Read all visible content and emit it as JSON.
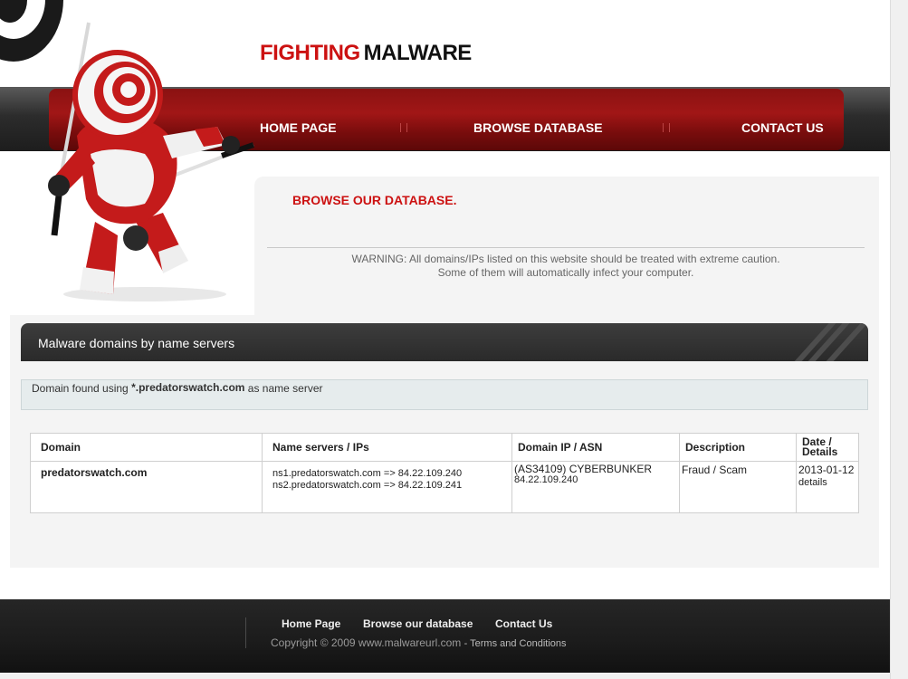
{
  "header": {
    "title_red": "FIGHTING",
    "title_black": "MALWARE"
  },
  "nav": {
    "items": [
      {
        "label": "HOME PAGE"
      },
      {
        "label": "BROWSE DATABASE"
      },
      {
        "label": "CONTACT US"
      }
    ]
  },
  "browse": {
    "heading": "BROWSE OUR DATABASE.",
    "warning_line1": "WARNING: All domains/IPs listed on this website should be treated with extreme caution.",
    "warning_line2": "Some of them will automatically infect your computer."
  },
  "section": {
    "title": "Malware domains by name servers",
    "notice_prefix": "Domain found using ",
    "notice_ns": "*.predatorswatch.com",
    "notice_suffix": " as name server"
  },
  "table": {
    "headers": {
      "domain": "Domain",
      "name_servers": "Name servers / IPs",
      "domain_ip": "Domain IP / ASN",
      "description": "Description",
      "date_line1": "Date /",
      "date_line2": "Details"
    },
    "rows": [
      {
        "domain": "predatorswatch.com",
        "ns1": "ns1.predatorswatch.com => 84.22.109.240",
        "ns2": "ns2.predatorswatch.com => 84.22.109.241",
        "asn": "(AS34109) CYBERBUNKER",
        "ip": "84.22.109.240",
        "description": "Fraud / Scam",
        "date": "2013-01-12",
        "details": "details"
      }
    ]
  },
  "footer": {
    "links": [
      {
        "label": "Home Page"
      },
      {
        "label": "Browse our database"
      },
      {
        "label": "Contact Us"
      }
    ],
    "copyright": "Copyright © 2009 www.malwareurl.com",
    "terms": "- Terms and Conditions"
  },
  "colors": {
    "accent_red": "#cc1111",
    "nav_red": "#a11616",
    "dark": "#2a2a2a"
  }
}
